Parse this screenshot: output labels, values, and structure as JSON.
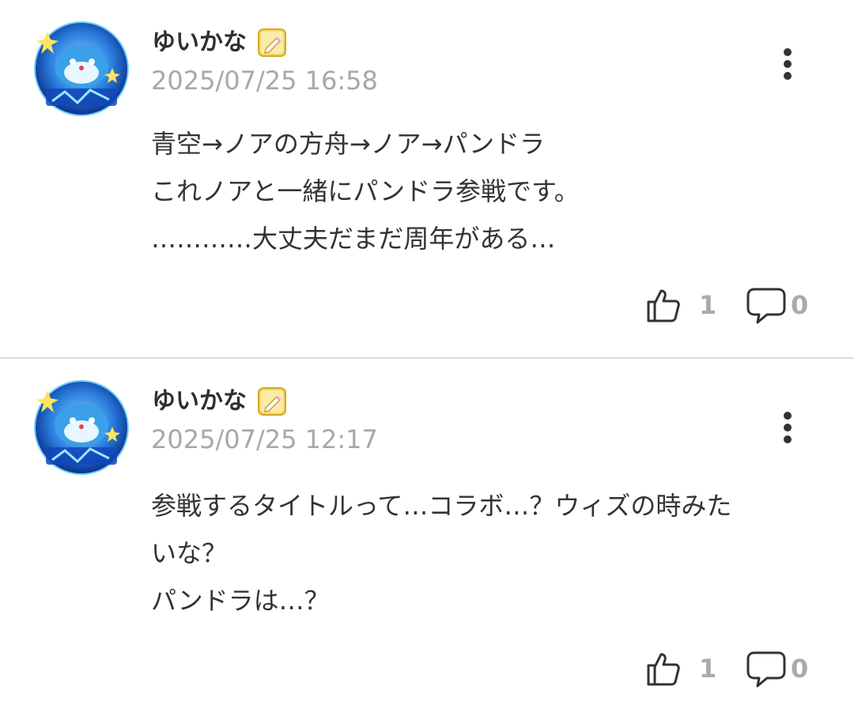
{
  "colors": {
    "text": "#333333",
    "muted": "#a8a8a8",
    "count": "#aaaaaa",
    "divider": "#dcdcdc",
    "badge": "#f2c94c"
  },
  "icons": {
    "avatar": "blue-mascot-avatar",
    "badge": "pencil-badge-icon",
    "more": "more-vertical-icon",
    "like": "thumbs-up-icon",
    "reply": "speech-bubble-icon"
  },
  "comments": [
    {
      "username": "ゆいかな",
      "timestamp": "2025/07/25 16:58",
      "lines": [
        "青空→ノアの方舟→ノア→パンドラ",
        "これノアと一緒にパンドラ参戦です。",
        "…………大丈夫だまだ周年がある…"
      ],
      "likes": "1",
      "replies": "0"
    },
    {
      "username": "ゆいかな",
      "timestamp": "2025/07/25 12:17",
      "lines": [
        "参戦するタイトルって…コラボ…？ウィズの時みた",
        "いな？",
        "パンドラは…？"
      ],
      "likes": "1",
      "replies": "0"
    }
  ]
}
